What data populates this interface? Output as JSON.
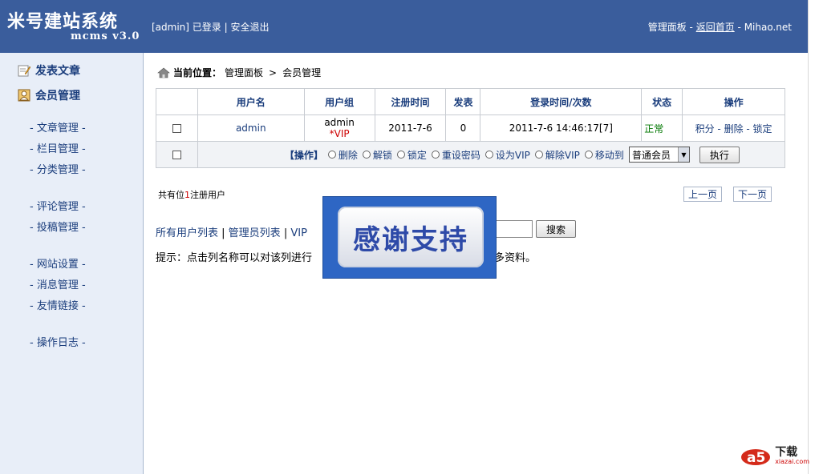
{
  "header": {
    "logo_title": "米号建站系统",
    "logo_version": "mcms v3.0",
    "user_status": "[admin] 已登录",
    "logout": "安全退出",
    "panel": "管理面板",
    "back_home": "返回首页",
    "site": "Mihao.net"
  },
  "sidebar": {
    "main": [
      {
        "label": "发表文章",
        "icon": "edit-icon"
      },
      {
        "label": "会员管理",
        "icon": "member-icon"
      }
    ],
    "links": [
      "文章管理",
      "栏目管理",
      "分类管理",
      "评论管理",
      "投稿管理",
      "网站设置",
      "消息管理",
      "友情链接",
      "操作日志"
    ]
  },
  "breadcrumb": {
    "prefix": "当前位置：",
    "panel": "管理面板",
    "sep": ">",
    "current": "会员管理"
  },
  "table": {
    "headers": [
      "用户名",
      "用户组",
      "注册时间",
      "发表",
      "登录时间/次数",
      "状态",
      "操作"
    ],
    "rows": [
      {
        "username": "admin",
        "group": "admin",
        "group_badge": "*VIP",
        "reg_time": "2011-7-6",
        "posts": "0",
        "login": "2011-7-6 14:46:17[7]",
        "status": "正常",
        "act_points": "积分",
        "act_delete": "删除",
        "act_lock": "锁定"
      }
    ],
    "batch_label": "【操作】",
    "batch_options": [
      "删除",
      "解锁",
      "锁定",
      "重设密码",
      "设为VIP",
      "解除VIP",
      "移动到"
    ],
    "move_target": "普通会员",
    "execute": "执行"
  },
  "summary": {
    "prefix": "共有位",
    "count": "1",
    "suffix": "注册用户"
  },
  "pager": {
    "prev": "上一页",
    "next": "下一页"
  },
  "lists": {
    "all": "所有用户列表",
    "admin": "管理员列表",
    "vip": "VIP"
  },
  "search": {
    "button": "搜索"
  },
  "tip": {
    "before": "提示：点击列名称可以对该列进行",
    "after": "更多资料。"
  },
  "overlay": {
    "text": "感谢支持"
  },
  "watermark": {
    "text": "下载",
    "sub": "xiazai.com"
  },
  "colors": {
    "header_bg": "#3a5d9c",
    "sidebar_bg": "#e8eef8",
    "link": "#1a3d7c",
    "vip": "#cc0000",
    "ok": "#007700"
  }
}
